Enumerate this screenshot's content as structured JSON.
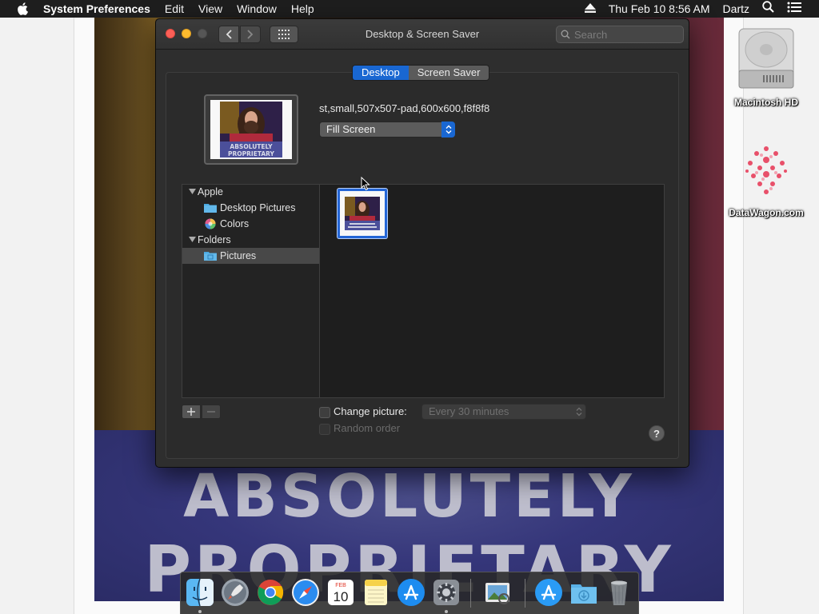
{
  "menubar": {
    "app_name": "System Preferences",
    "items": [
      "Edit",
      "View",
      "Window",
      "Help"
    ],
    "datetime": "Thu Feb 10  8:56 AM",
    "user": "Dartz"
  },
  "desktop": {
    "wallpaper_text_line1": "ABSOLUTELY",
    "wallpaper_text_line2": "PROPRIETARY",
    "icons": [
      {
        "label": "Macintosh HD"
      },
      {
        "label": "DataWagon.com"
      }
    ]
  },
  "window": {
    "title": "Desktop & Screen Saver",
    "search_placeholder": "Search",
    "tabs": [
      {
        "label": "Desktop",
        "selected": true
      },
      {
        "label": "Screen Saver",
        "selected": false
      }
    ],
    "current_image_name": "st,small,507x507-pad,600x600,f8f8f8",
    "preview_caption_line1": "ABSOLUTELY",
    "preview_caption_line2": "PROPRIETARY",
    "fill_mode": "Fill Screen",
    "sources": {
      "apple_group": "Apple",
      "desktop_pictures": "Desktop Pictures",
      "colors": "Colors",
      "folders_group": "Folders",
      "pictures": "Pictures"
    },
    "change_picture_label": "Change picture:",
    "change_picture_checked": false,
    "interval": "Every 30 minutes",
    "random_order_label": "Random order",
    "help_label": "?"
  },
  "dock": {
    "apps": [
      "finder-icon",
      "launchpad-icon",
      "chrome-icon",
      "safari-icon",
      "calendar-icon",
      "notes-icon",
      "app-store-icon",
      "system-preferences-icon",
      "preview-icon",
      "app-store-downloads-icon",
      "downloads-folder-icon",
      "trash-icon"
    ],
    "calendar_month": "FEB",
    "calendar_day": "10"
  },
  "colors": {
    "accent": "#1967d2",
    "window_bg": "#2e2e2e",
    "menubar_bg": "#1e1e1e"
  }
}
